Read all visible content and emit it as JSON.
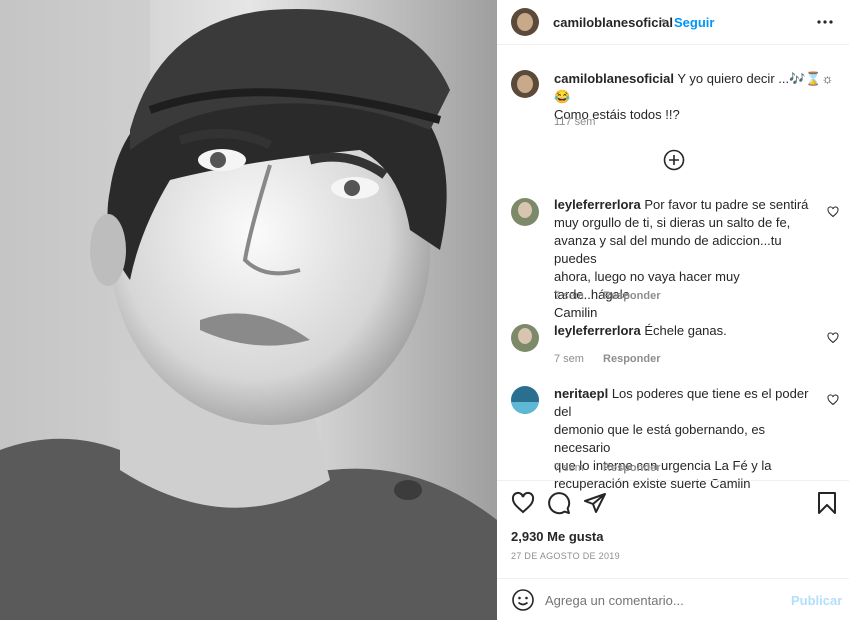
{
  "post": {
    "author": "camiloblanesoficial",
    "follow_label": "Seguir",
    "caption": {
      "username": "camiloblanesoficial",
      "line1": "Y yo quiero decir ...🎶⌛☼😂",
      "line2": "Como estáis todos !!?",
      "time": "117 sem"
    }
  },
  "comments": [
    {
      "username": "leyleferrerlora",
      "lines": [
        "Por favor tu padre se sentirá",
        "muy orgullo de ti, si dieras un salto de fe,",
        "avanza y sal del mundo de adiccion...tu puedes",
        "ahora, luego no vaya hacer muy tarde..hágale",
        "Camilin"
      ],
      "time": "7 sem",
      "reply_label": "Responder"
    },
    {
      "username": "leyleferrerlora",
      "lines": [
        "Échele ganas."
      ],
      "time": "7 sem",
      "reply_label": "Responder"
    },
    {
      "username": "neritaepl",
      "lines": [
        "Los poderes que tiene es el poder del",
        "demonio que le está gobernando, es necesario",
        "que lo interne con urgencia La Fé y la",
        "recuperación existe suerte Camlin"
      ],
      "time": "7 sem",
      "reply_label": "Responder"
    }
  ],
  "stats": {
    "likes": "2,930 Me gusta",
    "date": "27 DE AGOSTO DE 2019"
  },
  "add_comment": {
    "placeholder": "Agrega un comentario...",
    "publish_label": "Publicar"
  },
  "colors": {
    "accent": "#0095f6",
    "publish_disabled": "#b2dffc",
    "muted": "#8e8e8e"
  }
}
